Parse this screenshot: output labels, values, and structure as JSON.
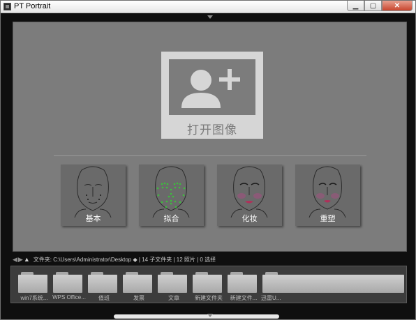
{
  "window": {
    "title": "PT Portrait",
    "controls": {
      "minimize": "▁",
      "maximize": "▢",
      "close": "✕"
    }
  },
  "main": {
    "open_image_label": "打开图像",
    "modes": [
      {
        "id": "basic",
        "label": "基本"
      },
      {
        "id": "fit",
        "label": "拟合"
      },
      {
        "id": "makeup",
        "label": "化妆"
      },
      {
        "id": "reshape",
        "label": "重塑"
      }
    ]
  },
  "pathbar": {
    "back_icon": "arrow-left-icon",
    "forward_icon": "arrow-right-icon",
    "up_icon": "arrow-up-icon",
    "text": "文件夹: C:\\Users\\Administrator\\Desktop ◆ | 14 子文件夹 | 12 照片 | 0 选择"
  },
  "filmstrip": {
    "folders": [
      {
        "label": "win7系统..."
      },
      {
        "label": "WPS Office..."
      },
      {
        "label": "值班"
      },
      {
        "label": "发票"
      },
      {
        "label": "文章"
      },
      {
        "label": "新建文件夹"
      },
      {
        "label": "新建文件..."
      },
      {
        "label": "迅雷U..."
      }
    ]
  },
  "colors": {
    "panel": "#7c7c7c",
    "card": "#6a6a6a",
    "fit_dots": "#3cbf3c",
    "lipstick": "#b0305a"
  }
}
